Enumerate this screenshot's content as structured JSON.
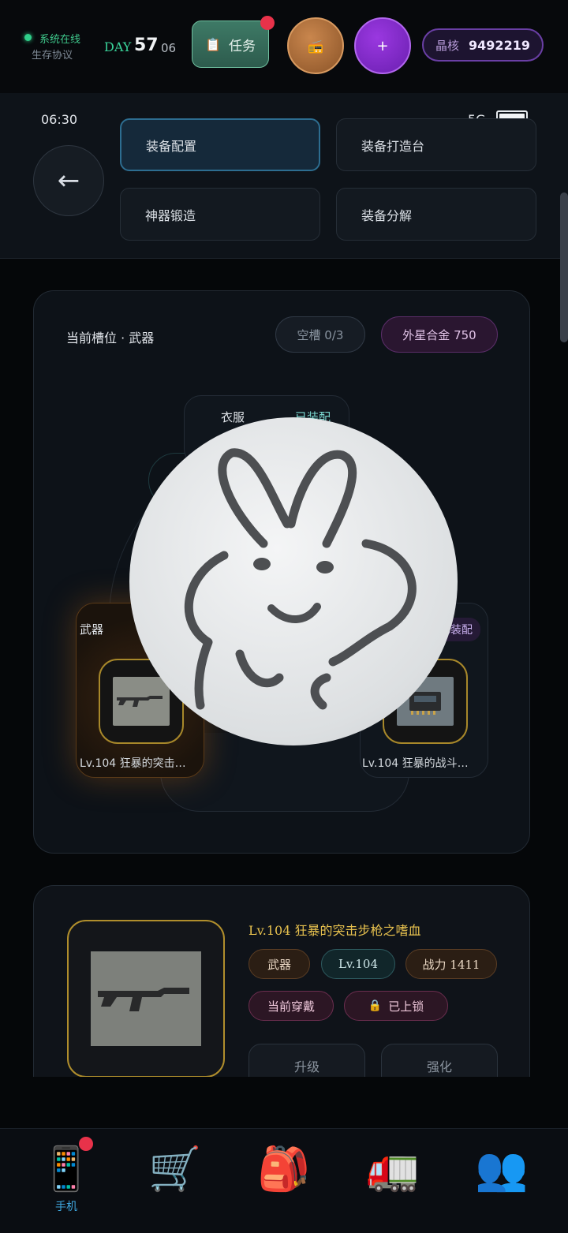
{
  "topbar": {
    "status_online": "系统在线",
    "status_protocol": "生存协议",
    "day_label": "DAY",
    "day_number": "57",
    "day_sub": "06",
    "task_icon": "📋",
    "task_label": "任务",
    "radio_icon": "📻",
    "plus_label": "+",
    "crystal_label": "晶核",
    "crystal_value": "9492219"
  },
  "phone": {
    "time": "06:30",
    "network": "5G",
    "back_label": "←",
    "menu": [
      {
        "label": "装备配置",
        "active": true
      },
      {
        "label": "装备打造台",
        "active": false
      },
      {
        "label": "神器锻造",
        "active": false
      },
      {
        "label": "装备分解",
        "active": false
      }
    ]
  },
  "slot_panel": {
    "title": "当前槽位 · 武器",
    "empty_slots": "空槽 0/3",
    "alloy": "外星合金 750",
    "center_category": "衣服",
    "center_status": "已装配",
    "weapon_card": {
      "category": "武器",
      "name": "Lv.104 狂暴的突击…"
    },
    "chip_card": {
      "status": "已装配",
      "name": "Lv.104 狂暴的战斗…"
    }
  },
  "detail": {
    "title": "Lv.104 狂暴的突击步枪之嗜血",
    "tags": [
      "武器",
      "Lv.104",
      "战力 1411"
    ],
    "status_tags": [
      "当前穿戴",
      "已上锁"
    ],
    "lock_icon": "🔒",
    "actions": [
      "升级",
      "强化"
    ]
  },
  "bottom_nav": {
    "items": [
      {
        "icon": "📱",
        "label": "手机",
        "active": true
      },
      {
        "icon": "🛒",
        "label": ""
      },
      {
        "icon": "🎒",
        "label": ""
      },
      {
        "icon": "🚛",
        "label": ""
      },
      {
        "icon": "👥",
        "label": ""
      }
    ]
  },
  "colors": {
    "accent_green": "#39d39a",
    "gold": "#e6c04e",
    "purple": "#8e3ad8",
    "alert_red": "#e8324a"
  }
}
